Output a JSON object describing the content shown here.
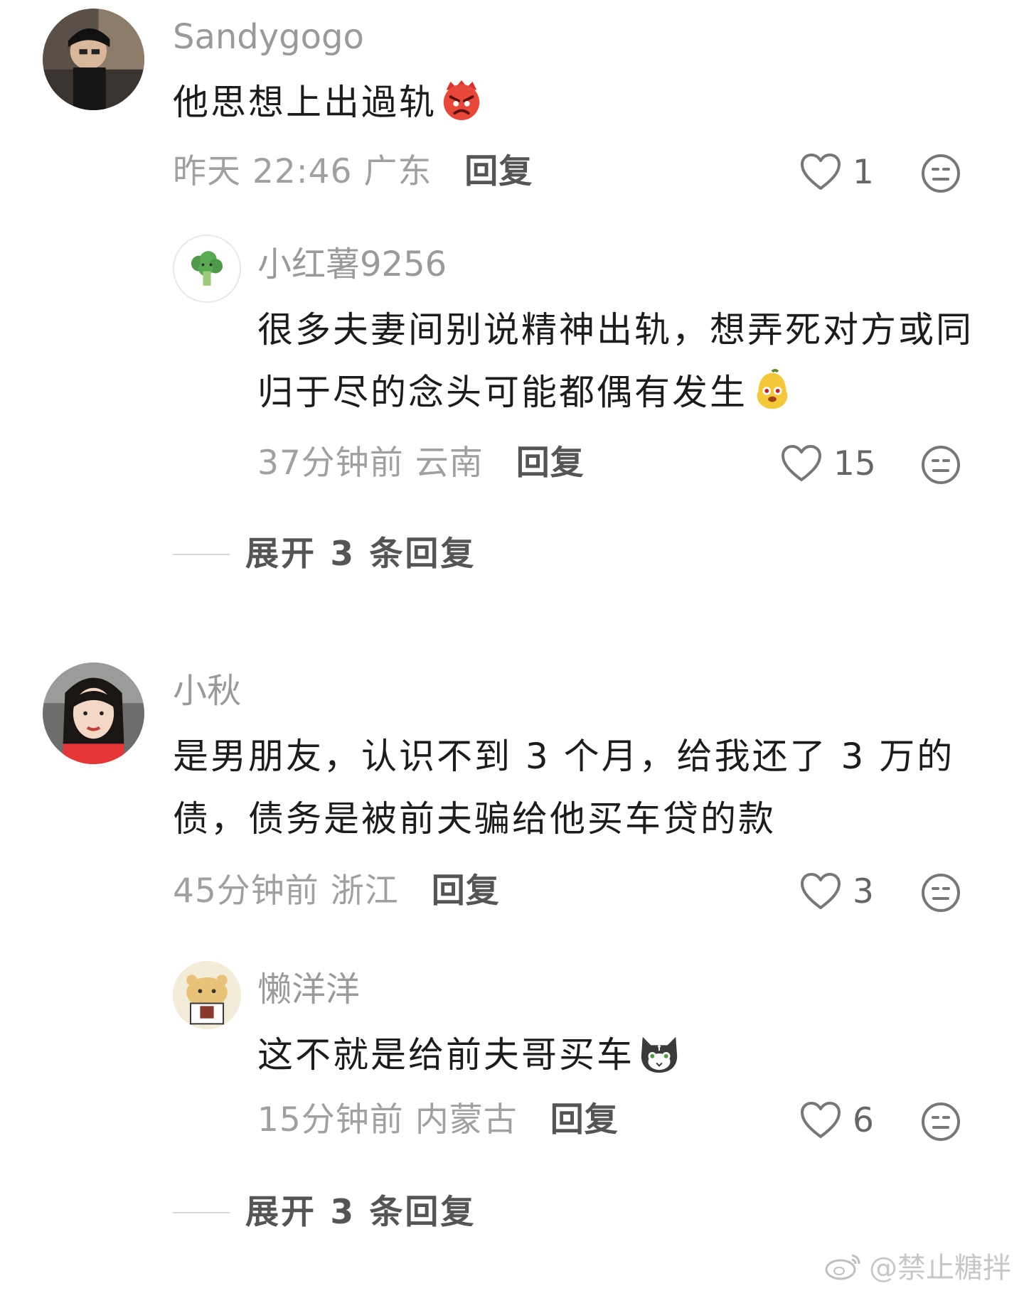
{
  "comments": [
    {
      "username": "Sandygogo",
      "text": "他思想上出過轨",
      "emoji": "angry-face-emoji",
      "time": "昨天 22:46",
      "location": "广东",
      "reply_label": "回复",
      "likes": "1",
      "replies": [
        {
          "username": "小红薯9256",
          "text": "很多夫妻间别说精神出轨，想弄死对方或同归于尽的念头可能都偶有发生",
          "emoji": "pear-face-emoji",
          "time": "37分钟前",
          "location": "云南",
          "reply_label": "回复",
          "likes": "15"
        }
      ],
      "expand_label": "展开 3 条回复"
    },
    {
      "username": "小秋",
      "text": "是男朋友，认识不到 3 个月，给我还了 3 万的债，债务是被前夫骗给他买车贷的款",
      "time": "45分钟前",
      "location": "浙江",
      "reply_label": "回复",
      "likes": "3",
      "replies": [
        {
          "username": "懒洋洋",
          "text": "这不就是给前夫哥买车",
          "emoji": "cat-face-emoji",
          "time": "15分钟前",
          "location": "内蒙古",
          "reply_label": "回复",
          "likes": "6"
        }
      ],
      "expand_label": "展开 3 条回复"
    }
  ],
  "watermark": "@禁止糖拌",
  "colors": {
    "username": "#9a9a9a",
    "text": "#1c1c1c",
    "meta": "#a0a0a0",
    "reply": "#555555"
  }
}
